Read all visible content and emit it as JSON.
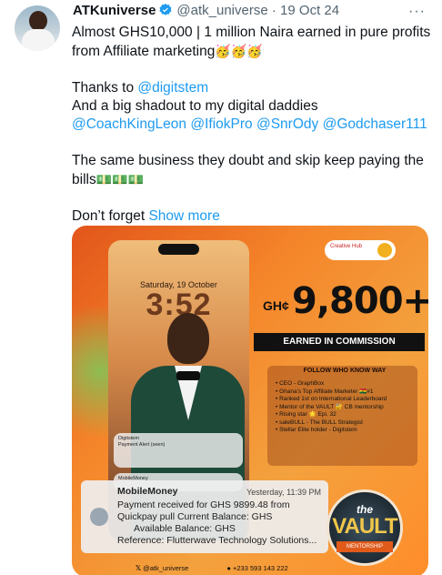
{
  "author": {
    "name": "ATKuniverse",
    "handle": "@atk_universe",
    "separator": "·",
    "date": "19 Oct 24",
    "verified_color": "#1d9bf0"
  },
  "more_label": "···",
  "tweet": {
    "line1": "Almost GHS10,000 | 1 million Naira earned in pure profits from Affiliate marketing",
    "line1_emoji": "🥳🥳🥳",
    "thanks_prefix": "Thanks to ",
    "thanks_mention": "@digitstem",
    "shoutout": "And a big shadout to my digital daddies",
    "mentions": [
      "@CoachKingLeon",
      "@IfiokPro",
      "@SnrOdy",
      "@Godchaser111"
    ],
    "line_bills": "The same business they doubt and skip keep paying the bills",
    "bills_emoji": "💵💵💵",
    "dont_forget": "Don’t forget ",
    "show_more": "Show more"
  },
  "media": {
    "phone": {
      "day": "Saturday, 19 October",
      "clock": "3:52",
      "notification1_title": "Digitstem",
      "notification1_sub": "Payment Alert (seen)",
      "notification2_title": "MobileMoney"
    },
    "brand_text": "Creative Hub",
    "amount_currency": "GH¢",
    "amount_value": "9,800+",
    "earned_label": "EARNED IN COMMISSION",
    "follow_label": "FOLLOW WHO KNOW WAY",
    "bullets": [
      "CEO - GraphBox",
      "Ghana's Top Affiliate Marketer 🇬🇭#1",
      "Ranked 1st on International Leaderboard",
      "Mentor of the VAULT 🔐 CB mentorship",
      "Rising star 🌟 Epi. 32",
      "saleBULL - The BULL Strategist",
      "Stellar Elite holder - Digitstem"
    ],
    "vault": {
      "the": "the",
      "name": "VAULT",
      "sub": "MENTORSHIP"
    },
    "mobile_money": {
      "title": "MobileMoney",
      "time": "Yesterday, 11:39 PM",
      "line1": "Payment received for GHS 9899.48 from",
      "line2": "Quickpay pull  Current Balance: GHS",
      "line3": "Available Balance: GHS",
      "line4": "Reference: Flutterwave Technology Solutions..."
    },
    "footer_handle": "@atk_universe",
    "footer_phone": "+233 593 143 222"
  }
}
